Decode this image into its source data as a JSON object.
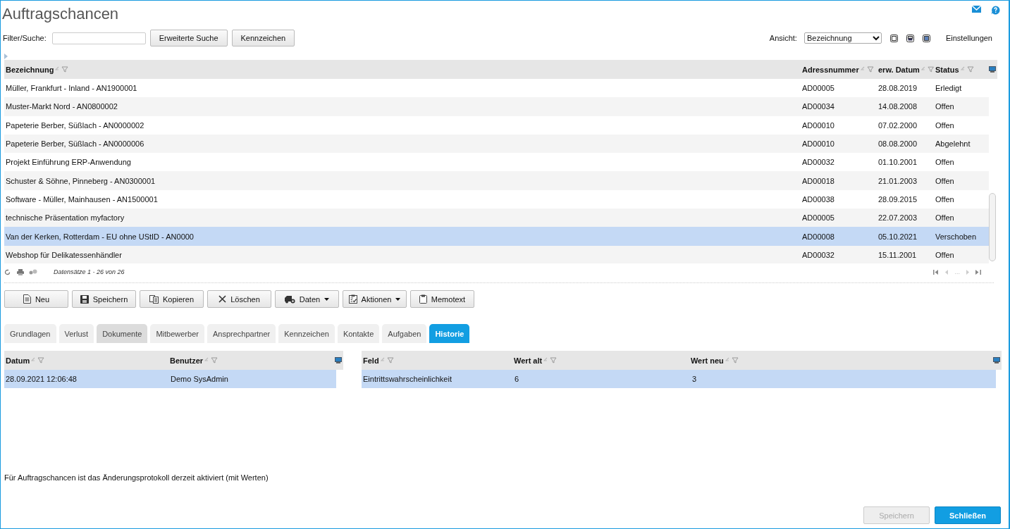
{
  "title": "Auftragschancen",
  "filter": {
    "label": "Filter/Suche:",
    "buttons": [
      "Erweiterte Suche",
      "Kennzeichen"
    ]
  },
  "view": {
    "label": "Ansicht:",
    "value": "Bezeichnung",
    "settings": "Einstellungen"
  },
  "grid": {
    "columns": [
      "Bezeichnung",
      "Adressnummer",
      "erw. Datum",
      "Status"
    ],
    "rows": [
      {
        "cells": [
          "Müller, Frankfurt - Inland - AN1900001",
          "AD00005",
          "28.08.2019",
          "Erledigt"
        ],
        "selected": false
      },
      {
        "cells": [
          "Muster-Markt Nord - AN0800002",
          "AD00034",
          "14.08.2008",
          "Offen"
        ],
        "selected": false
      },
      {
        "cells": [
          "Papeterie Berber, Süßlach - AN0000002",
          "AD00010",
          "07.02.2000",
          "Offen"
        ],
        "selected": false
      },
      {
        "cells": [
          "Papeterie Berber, Süßlach - AN0000006",
          "AD00010",
          "08.08.2000",
          "Abgelehnt"
        ],
        "selected": false
      },
      {
        "cells": [
          "Projekt Einführung ERP-Anwendung",
          "AD00032",
          "01.10.2001",
          "Offen"
        ],
        "selected": false
      },
      {
        "cells": [
          "Schuster & Söhne, Pinneberg - AN0300001",
          "AD00018",
          "21.01.2003",
          "Offen"
        ],
        "selected": false
      },
      {
        "cells": [
          "Software - Müller, Mainhausen - AN1500001",
          "AD00038",
          "28.09.2015",
          "Offen"
        ],
        "selected": false
      },
      {
        "cells": [
          "technische Präsentation myfactory",
          "AD00005",
          "22.07.2003",
          "Offen"
        ],
        "selected": false
      },
      {
        "cells": [
          "Van der Kerken, Rotterdam - EU ohne UStID - AN0000",
          "AD00008",
          "05.10.2021",
          "Verschoben"
        ],
        "selected": true
      },
      {
        "cells": [
          "Webshop für Delikatessenhändler",
          "AD00032",
          "15.11.2001",
          "Offen"
        ],
        "selected": false
      }
    ],
    "records": "Datensätze 1 - 26 von 26",
    "pager": "..."
  },
  "actions": [
    {
      "label": "Neu",
      "kind": "new",
      "menu": false
    },
    {
      "label": "Speichern",
      "kind": "save",
      "menu": false
    },
    {
      "label": "Kopieren",
      "kind": "copy",
      "menu": false
    },
    {
      "label": "Löschen",
      "kind": "delete",
      "menu": false
    },
    {
      "label": "Daten",
      "kind": "data",
      "menu": true
    },
    {
      "label": "Aktionen",
      "kind": "actions",
      "menu": true
    },
    {
      "label": "Memotext",
      "kind": "memo",
      "menu": false
    }
  ],
  "tabs": [
    {
      "label": "Grundlagen",
      "selected": false,
      "hover": false
    },
    {
      "label": "Verlust",
      "selected": false,
      "hover": false
    },
    {
      "label": "Dokumente",
      "selected": false,
      "hover": true
    },
    {
      "label": "Mitbewerber",
      "selected": false,
      "hover": false
    },
    {
      "label": "Ansprechpartner",
      "selected": false,
      "hover": false
    },
    {
      "label": "Kennzeichen",
      "selected": false,
      "hover": false
    },
    {
      "label": "Kontakte",
      "selected": false,
      "hover": false
    },
    {
      "label": "Aufgaben",
      "selected": false,
      "hover": false
    },
    {
      "label": "Historie",
      "selected": true,
      "hover": false
    }
  ],
  "history": {
    "changes": {
      "columns": [
        "Datum",
        "Benutzer"
      ],
      "rows": [
        {
          "cells": [
            "28.09.2021 12:06:48",
            "Demo SysAdmin"
          ],
          "selected": true
        }
      ]
    },
    "fields": {
      "columns": [
        "Feld",
        "Wert alt",
        "Wert neu"
      ],
      "rows": [
        {
          "cells": [
            "Eintrittswahrscheinlichkeit",
            "6",
            "3"
          ],
          "selected": true
        }
      ]
    }
  },
  "note": "Für Auftragschancen ist das Änderungsprotokoll derzeit aktiviert (mit Werten)",
  "footer_buttons": [
    {
      "label": "Speichern",
      "disabled": true,
      "primary": false
    },
    {
      "label": "Schließen",
      "disabled": false,
      "primary": true
    }
  ]
}
